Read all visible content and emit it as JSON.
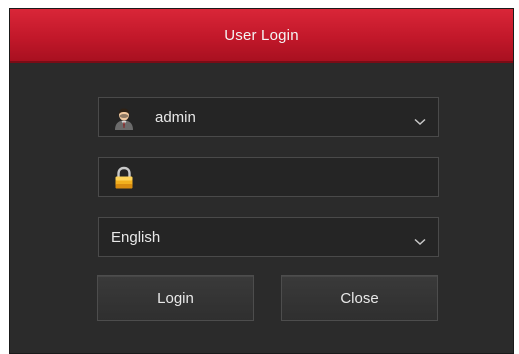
{
  "dialog": {
    "title": "User Login"
  },
  "username": {
    "value": "admin",
    "icon": "user-avatar-icon"
  },
  "password": {
    "value": "",
    "icon": "padlock-icon"
  },
  "language": {
    "value": "English"
  },
  "buttons": {
    "login_label": "Login",
    "close_label": "Close"
  },
  "colors": {
    "titlebar": "#c2182a",
    "panel": "#2b2b2b",
    "field": "#252525",
    "text": "#e8e8e8"
  }
}
